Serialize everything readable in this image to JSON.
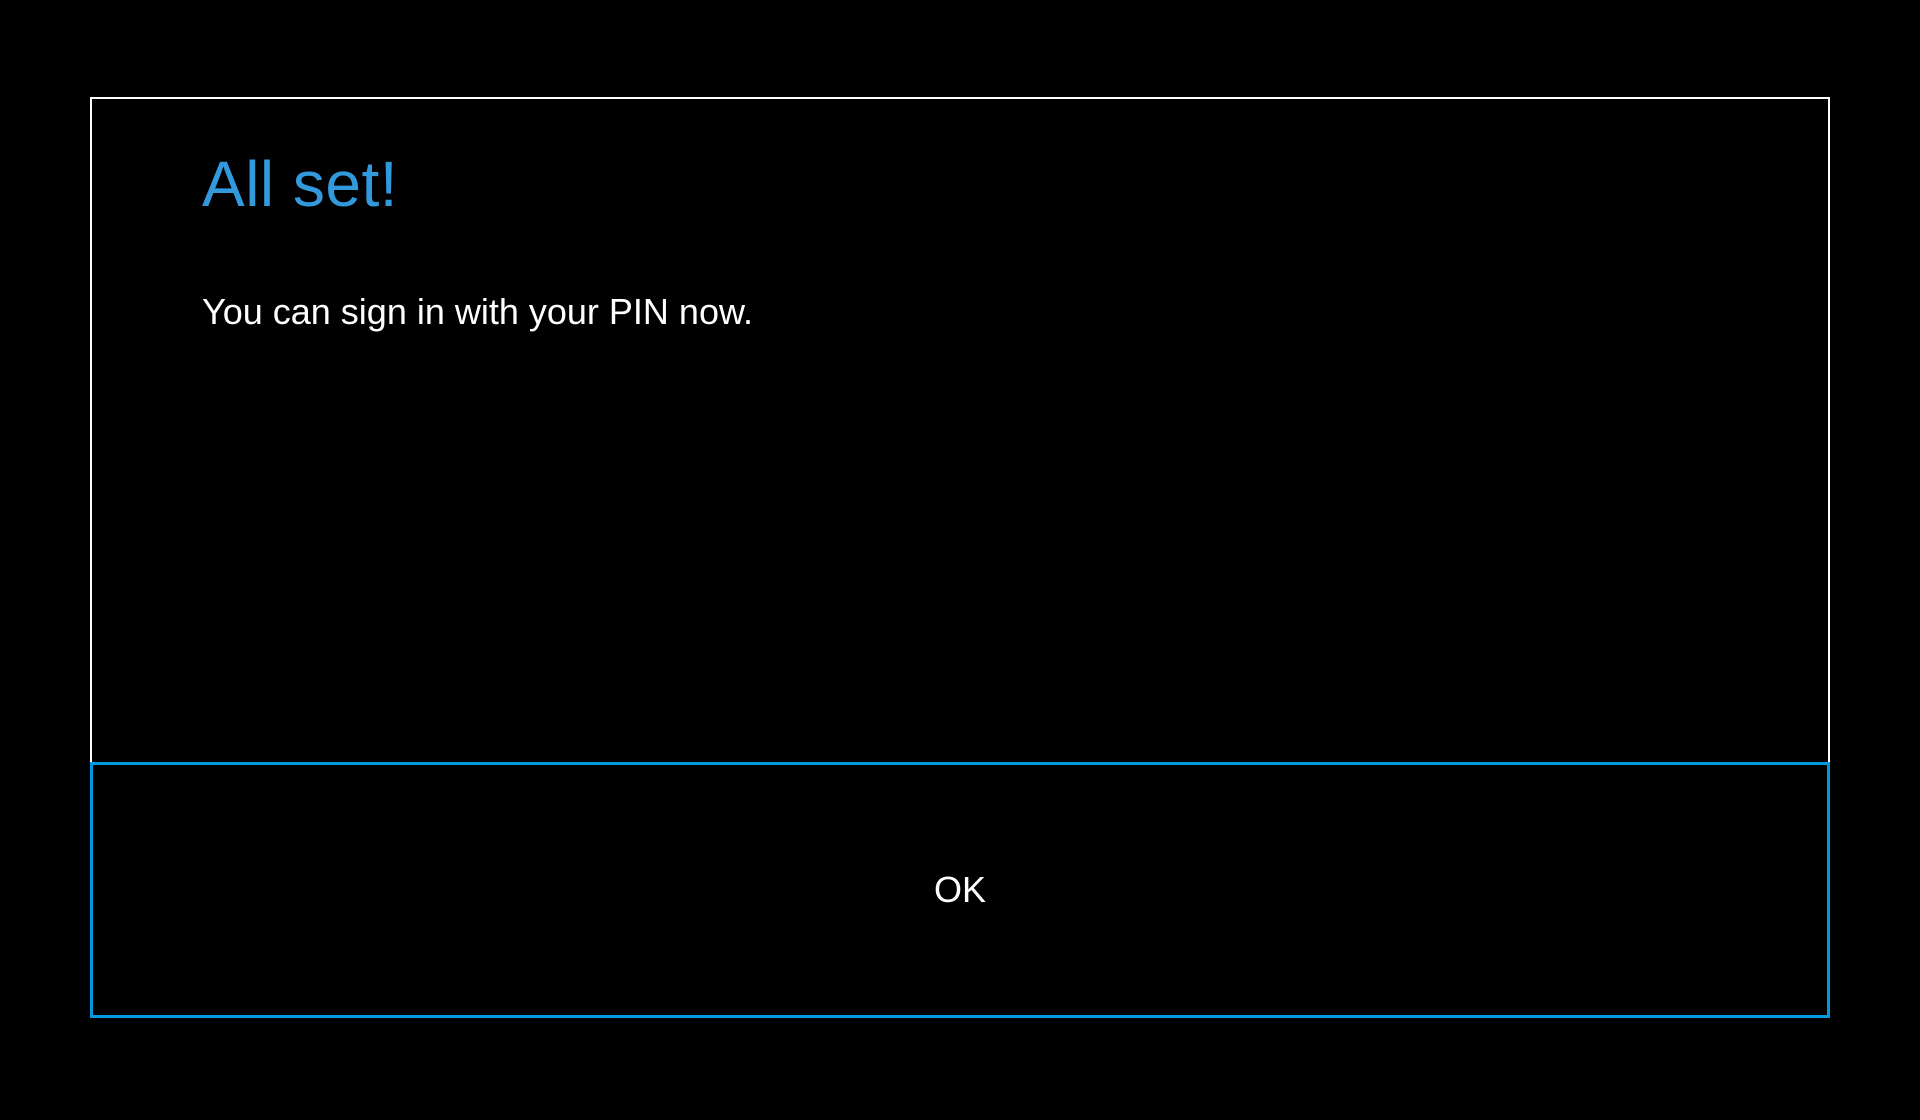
{
  "dialog": {
    "title": "All set!",
    "body": "You can sign in with your PIN now.",
    "ok_label": "OK"
  },
  "colors": {
    "accent": "#3399dd",
    "button_border": "#0099dd",
    "background": "#000000",
    "text": "#ffffff",
    "border": "#ffffff"
  }
}
